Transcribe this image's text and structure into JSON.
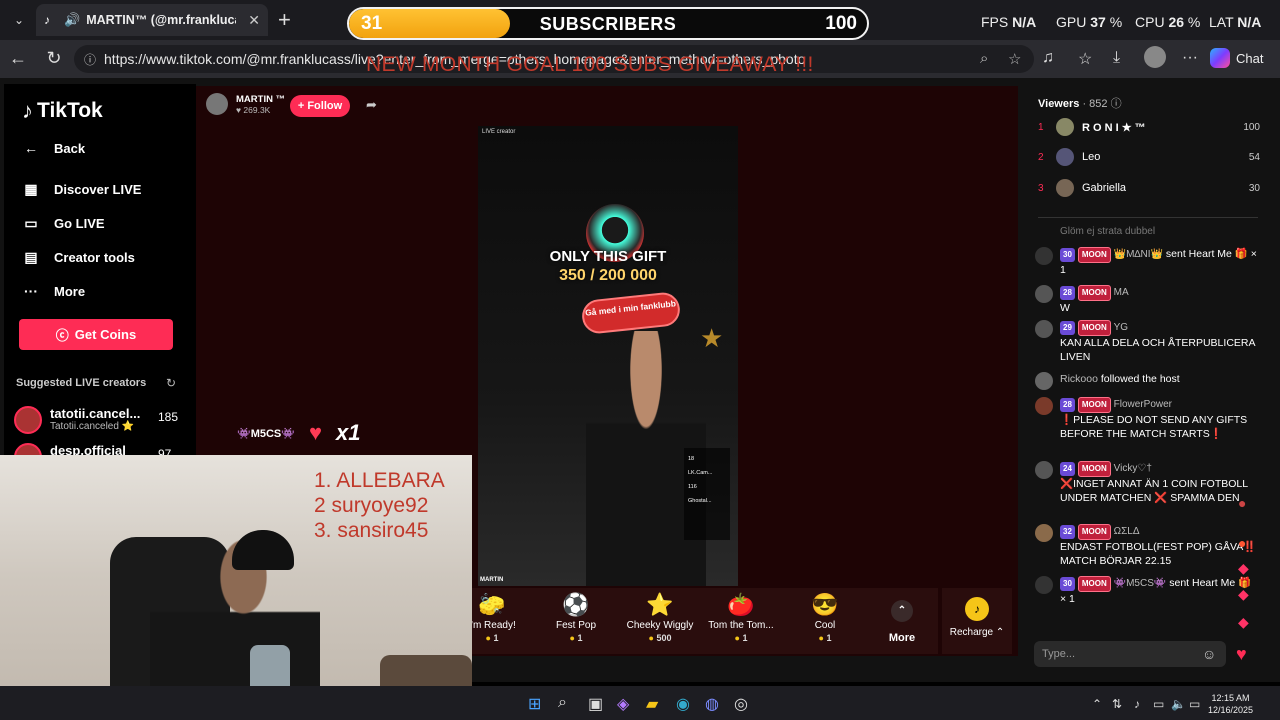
{
  "browser": {
    "tab_title": "MARTIN™ (@mr.franklucass)",
    "url": "https://www.tiktok.com/@mr.franklucass/live?enter_from_merge=others_homepage&enter_method=others_photo",
    "chat_label": "Chat"
  },
  "overlay": {
    "subs_current": "31",
    "subs_label": "SUBSCRIBERS",
    "subs_goal": "100",
    "subs_progress": 0.31,
    "goal_text": "NEW MONTH GOAL 100 SUBS GIVEAWAY !!!",
    "fps_label": "FPS",
    "fps_value": "N/A",
    "gpu_label": "GPU",
    "gpu_value": "37",
    "cpu_label": "CPU",
    "cpu_value": "26",
    "lat_label": "LAT",
    "lat_value": "N/A",
    "leaderboard": [
      "1.  ALLEBARA",
      "2   suryoye92",
      "3.  sansiro45"
    ]
  },
  "nav": {
    "logo": "TikTok",
    "back": "Back",
    "discover": "Discover LIVE",
    "go_live": "Go LIVE",
    "creator_tools": "Creator tools",
    "more": "More",
    "get_coins": "Get Coins",
    "suggested_title": "Suggested LIVE creators",
    "creators": [
      {
        "name": "tatotii.cancel...",
        "sub": "Tatotii.canceled ⭐",
        "count": "185"
      },
      {
        "name": "desp.official",
        "sub": "",
        "count": "97"
      }
    ]
  },
  "live": {
    "host_name": "MARTIN ™",
    "host_likes": "♥ 269.3K",
    "follow": "+ Follow",
    "video_tag": "LIVE creator",
    "gift_title": "ONLY THIS GIFT",
    "gift_count": "350 / 200 000",
    "fanclub": "Gå med i min fanklubb",
    "host_label": "MARTIN",
    "side_entries": [
      "18",
      "LK.Cam...",
      "116",
      "Ghostal..."
    ],
    "alert_user": "👾M5CS👾",
    "alert_mult": "x1",
    "gifts": [
      {
        "icon": "🧽",
        "name": "I'm Ready!",
        "price": "1"
      },
      {
        "icon": "⚽",
        "name": "Fest Pop",
        "price": "1"
      },
      {
        "icon": "⭐",
        "name": "Cheeky Wiggly",
        "price": "500"
      },
      {
        "icon": "🍅",
        "name": "Tom the Tom...",
        "price": "1"
      },
      {
        "icon": "😎",
        "name": "Cool",
        "price": "1"
      }
    ],
    "more": "More",
    "recharge": "Recharge"
  },
  "panel": {
    "viewers_label": "Viewers",
    "viewers_count": "· 852",
    "top_viewers": [
      {
        "rank": "1",
        "name": "R O N I ★ ™",
        "score": "100"
      },
      {
        "rank": "2",
        "name": "Leo",
        "score": "54"
      },
      {
        "rank": "3",
        "name": "Gabriella",
        "score": "30"
      }
    ],
    "chat_hint": "Glöm ej strata dubbel",
    "messages": [
      {
        "lvl": "30",
        "user": "👑M∆NI👑",
        "text": "sent Heart Me 🎁 × 1"
      },
      {
        "lvl": "28",
        "user": "MA",
        "text": "W"
      },
      {
        "lvl": "29",
        "user": "YG",
        "text": "KAN ALLA DELA OCH ÅTERPUBLICERA LIVEN"
      },
      {
        "lvl": "",
        "user": "Rickooo",
        "text": "followed the host"
      },
      {
        "lvl": "28",
        "user": "FlowerPower",
        "text": "❗PLEASE DO NOT SEND ANY GIFTS BEFORE THE MATCH STARTS❗"
      },
      {
        "lvl": "24",
        "user": "Vicky♡†",
        "text": "❌INGET ANNAT ÄN 1 COIN FOTBOLL UNDER MATCHEN ❌ SPAMMA DEN"
      },
      {
        "lvl": "32",
        "user": "ΩΣLΔ",
        "text": "ENDAST FOTBOLL(FEST POP) GÅVA‼️ MATCH BÖRJAR 22.15"
      },
      {
        "lvl": "30",
        "user": "👾M5CS👾",
        "text": "sent Heart Me 🎁 × 1"
      }
    ],
    "input_placeholder": "Type..."
  },
  "moon_label": "MOON",
  "taskbar": {
    "time": "12:15 AM",
    "date": "12/16/2025"
  }
}
